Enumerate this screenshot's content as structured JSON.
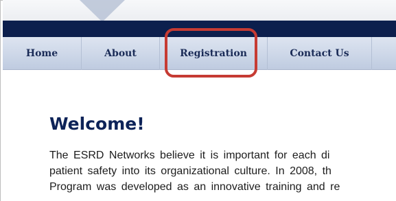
{
  "nav": {
    "items": [
      {
        "label": "Home"
      },
      {
        "label": "About"
      },
      {
        "label": "Registration"
      },
      {
        "label": "Contact Us"
      }
    ],
    "highlighted": "Registration"
  },
  "main": {
    "title": "Welcome!",
    "paragraph_lines": [
      "The ESRD Networks believe it is important for each di",
      "patient safety into its organizational culture. In 2008, th",
      "Program was developed as an innovative training and re"
    ]
  },
  "colors": {
    "header_bar": "#0c1f4d",
    "nav_text": "#1a2b57",
    "title": "#0d2358",
    "highlight": "#c63b33"
  }
}
